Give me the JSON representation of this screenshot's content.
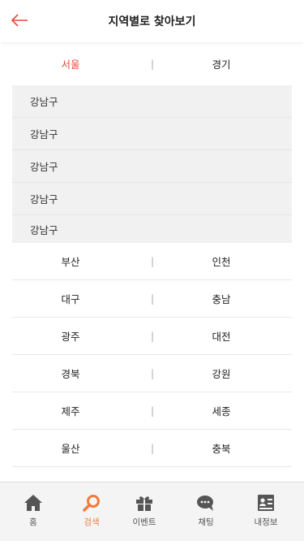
{
  "header": {
    "title": "지역별로 찾아보기",
    "back_icon": "arrow-left-icon",
    "accent": "#e8483c"
  },
  "rows": [
    {
      "left": "서울",
      "right": "경기",
      "left_active": true
    },
    {
      "left": "부산",
      "right": "인천"
    },
    {
      "left": "대구",
      "right": "충남"
    },
    {
      "left": "광주",
      "right": "대전"
    },
    {
      "left": "경북",
      "right": "강원"
    },
    {
      "left": "제주",
      "right": "세종"
    },
    {
      "left": "울산",
      "right": "충북"
    }
  ],
  "separator": "|",
  "districts": [
    "강남구",
    "강남구",
    "강남구",
    "강남구",
    "강남구"
  ],
  "tabbar": {
    "active_color": "#f07b3b",
    "tabs": [
      {
        "label": "홈",
        "icon": "home-icon"
      },
      {
        "label": "검색",
        "icon": "search-icon",
        "active": true
      },
      {
        "label": "이벤트",
        "icon": "gift-icon"
      },
      {
        "label": "채팅",
        "icon": "chat-icon"
      },
      {
        "label": "내정보",
        "icon": "profile-card-icon"
      }
    ]
  }
}
